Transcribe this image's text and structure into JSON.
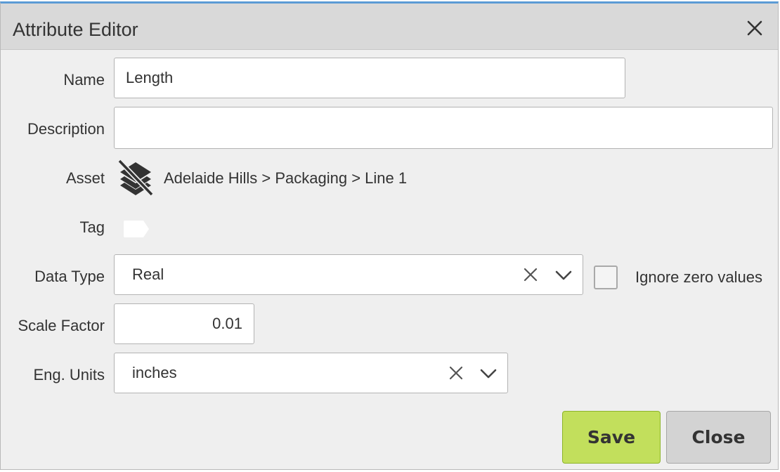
{
  "dialog": {
    "title": "Attribute Editor"
  },
  "fields": {
    "name": {
      "label": "Name",
      "value": "Length"
    },
    "description": {
      "label": "Description",
      "value": ""
    },
    "asset": {
      "label": "Asset",
      "path": "Adelaide Hills > Packaging > Line 1",
      "icon": "layers-off-icon"
    },
    "tag": {
      "label": "Tag"
    },
    "data_type": {
      "label": "Data Type",
      "value": "Real"
    },
    "ignore_zero": {
      "label": "Ignore zero values",
      "checked": false
    },
    "scale_factor": {
      "label": "Scale Factor",
      "value": "0.01"
    },
    "eng_units": {
      "label": "Eng. Units",
      "value": "inches"
    }
  },
  "buttons": {
    "save": "Save",
    "close": "Close"
  },
  "colors": {
    "accent": "#5b9bd5",
    "save_button": "#c2df5c",
    "close_button": "#d3d3d3"
  }
}
